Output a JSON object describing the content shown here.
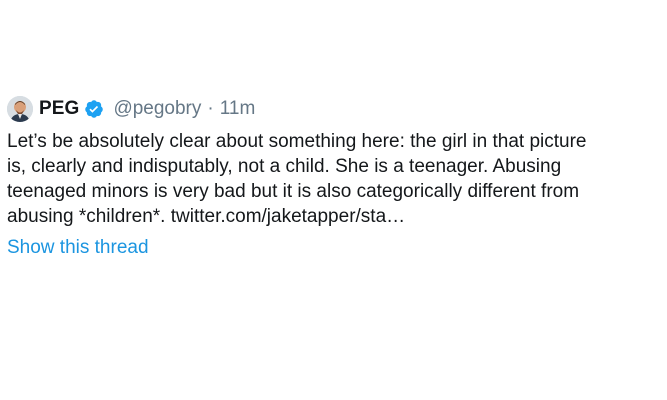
{
  "tweet": {
    "display_name": "PEG",
    "handle": "@pegobry",
    "separator": "·",
    "time": "11m",
    "text": "Let’s be absolutely clear about something here: the girl in that picture\nis, clearly and indisputably, not a child. She is a teenager. Abusing\nteenaged minors is very bad but it is also categorically different from\nabusing *children*. twitter.com/jaketapper/sta…",
    "show_thread_label": "Show this thread",
    "avatar_icon": "user-avatar",
    "verified_icon": "verified-badge-icon"
  },
  "colors": {
    "text": "#14171a",
    "muted": "#657786",
    "link": "#1b95e0",
    "verified": "#1da1f2"
  }
}
